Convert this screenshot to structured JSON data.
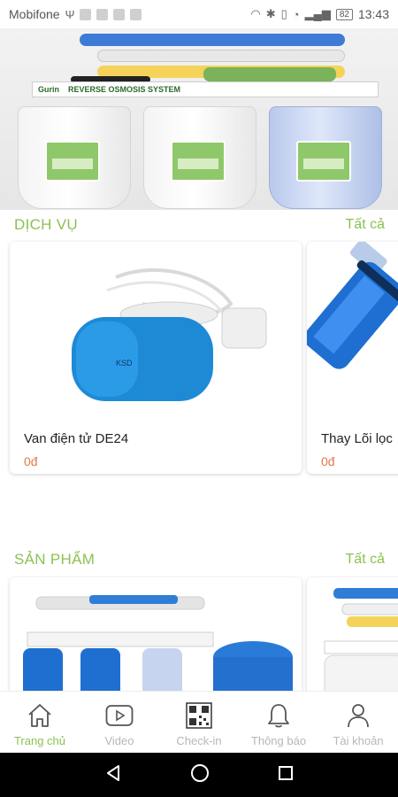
{
  "status_bar": {
    "carrier": "Mobifone",
    "battery": "82",
    "time": "13:43"
  },
  "banner": {
    "brand_text": "Gurin",
    "system_text": "REVERSE OSMOSIS SYSTEM",
    "slide_count": 3,
    "active_slide": 2
  },
  "services": {
    "title": "DỊCH VỤ",
    "see_all": "Tất cả",
    "items": [
      {
        "name": "Van điện tử DE24",
        "price": "0đ"
      },
      {
        "name": "Thay Lõi lọc",
        "price": "0đ"
      }
    ]
  },
  "products": {
    "title": "SẢN PHẨM",
    "see_all": "Tất cả",
    "items": [
      {
        "name": "",
        "price": ""
      },
      {
        "name": "",
        "price": ""
      }
    ]
  },
  "bottom_nav": {
    "items": [
      {
        "label": "Trang chủ",
        "icon": "home-icon",
        "active": true
      },
      {
        "label": "Video",
        "icon": "video-icon",
        "active": false
      },
      {
        "label": "Check-in",
        "icon": "qr-code-icon",
        "active": false
      },
      {
        "label": "Thông báo",
        "icon": "bell-icon",
        "active": false
      },
      {
        "label": "Tài khoản",
        "icon": "user-icon",
        "active": false
      }
    ]
  },
  "colors": {
    "accent": "#8cc152",
    "price": "#e07a4a",
    "inactive": "#b7b7b7"
  }
}
